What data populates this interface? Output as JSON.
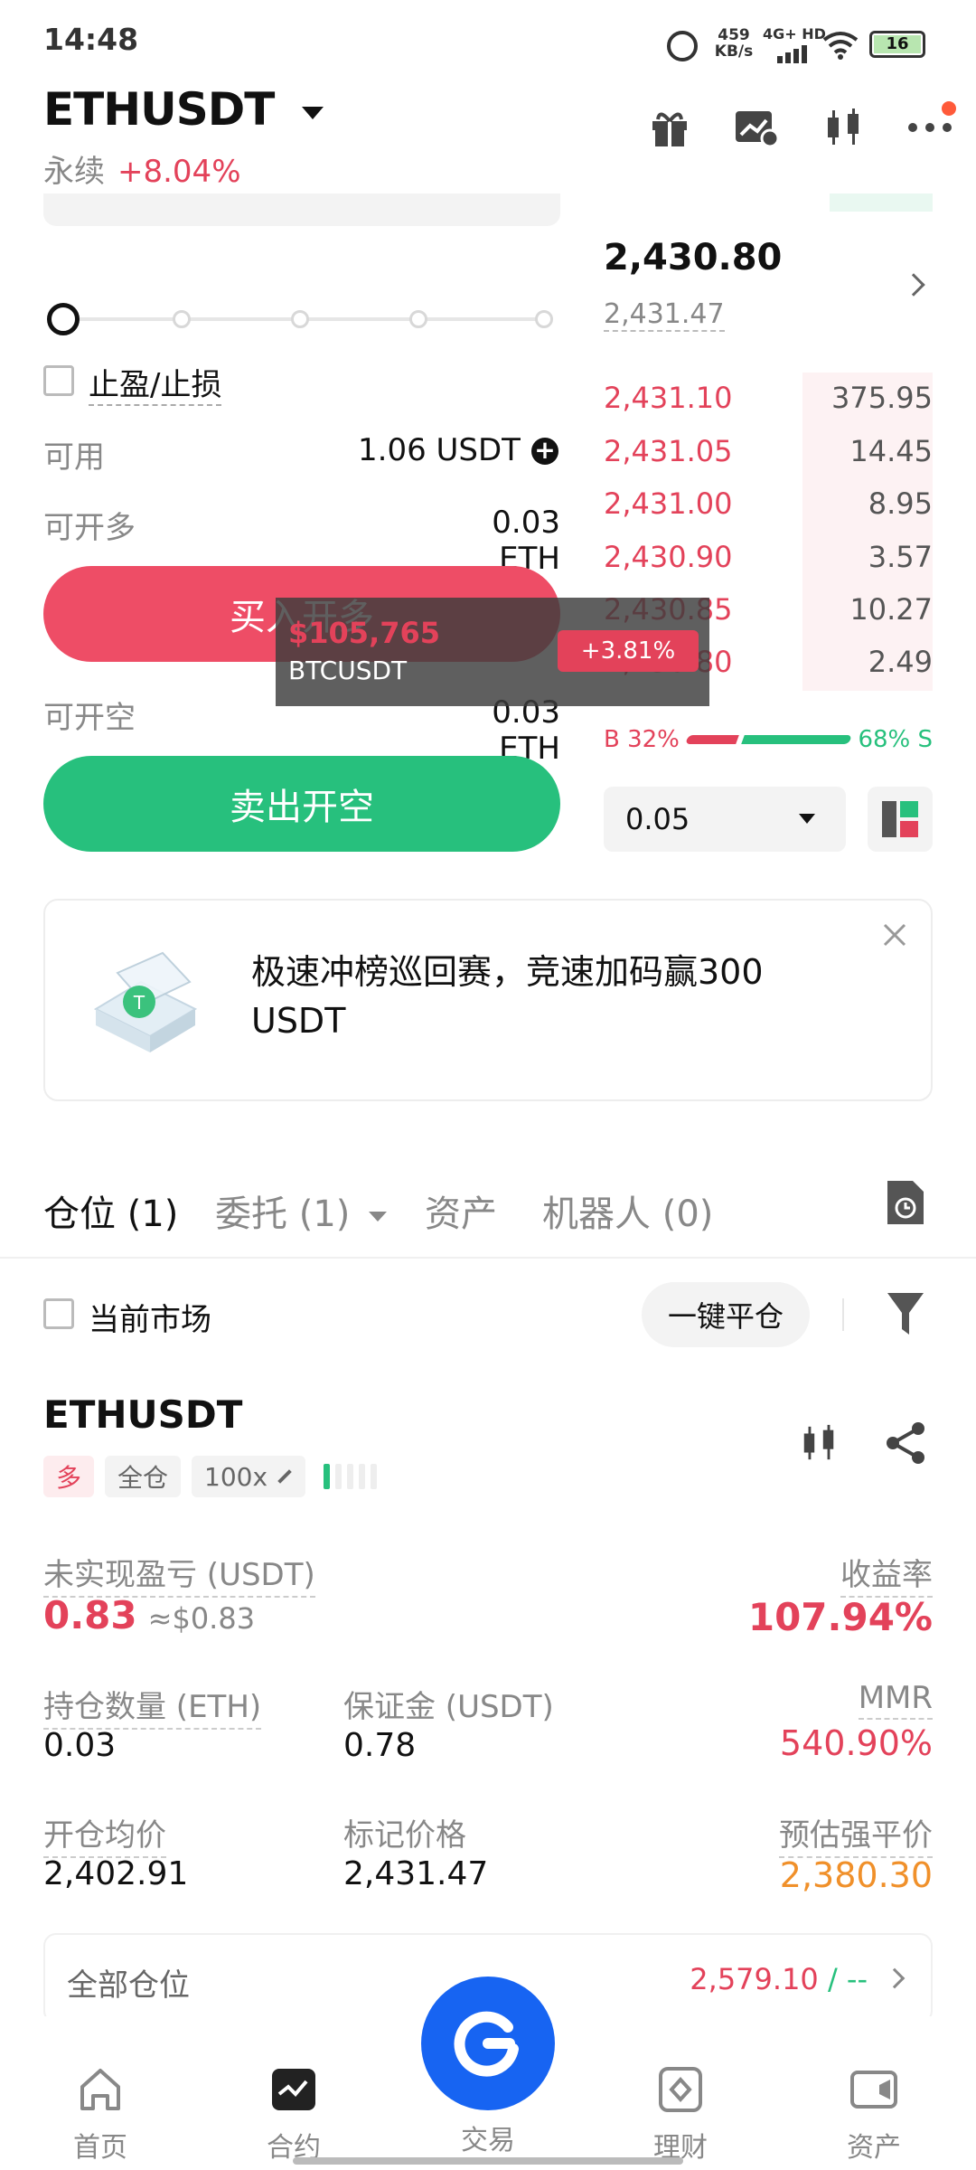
{
  "status_bar": {
    "time": "14:48",
    "speed": "459",
    "speed_unit": "KB/s",
    "network": "4G+ HD",
    "battery": "16"
  },
  "header": {
    "symbol": "ETHUSDT",
    "subtitle": "永续",
    "change": "+8.04%"
  },
  "order_form": {
    "tp_sl_label": "止盈/止损",
    "available_label": "可用",
    "available_value": "1.06 USDT",
    "can_open_long_label": "可开多",
    "can_open_long_value": "0.03 ETH",
    "buy_button": "买入开多",
    "can_open_short_label": "可开空",
    "can_open_short_value": "0.03 ETH",
    "sell_button": "卖出开空"
  },
  "orderbook": {
    "last_price": "2,430.80",
    "mark_price": "2,431.47",
    "asks": [
      {
        "price": "2,431.10",
        "qty": "375.95"
      },
      {
        "price": "2,431.05",
        "qty": "14.45"
      },
      {
        "price": "2,431.00",
        "qty": "8.95"
      },
      {
        "price": "2,430.90",
        "qty": "3.57"
      },
      {
        "price": "2,430.85",
        "qty": "10.27"
      },
      {
        "price": "2,430.80",
        "qty": "2.49"
      }
    ],
    "buy_ratio": "B 32%",
    "sell_ratio": "68% S",
    "buy_fraction": 0.32,
    "precision": "0.05"
  },
  "overlay": {
    "price": "$105,765",
    "symbol": "BTCUSDT",
    "change": "+3.81%"
  },
  "banner": {
    "text": "极速冲榜巡回赛，竞速加码赢300 USDT"
  },
  "tabs": [
    {
      "label": "仓位 (1)"
    },
    {
      "label": "委托 (1)"
    },
    {
      "label": "资产"
    },
    {
      "label": "机器人 (0)"
    }
  ],
  "filters": {
    "current_market_label": "当前市场",
    "close_all_button": "一键平仓"
  },
  "position": {
    "symbol": "ETHUSDT",
    "side_tag": "多",
    "margin_tag": "全仓",
    "leverage_tag": "100x",
    "upnl_label": "未实现盈亏 (USDT)",
    "upnl_value": "0.83",
    "upnl_usd": "≈$0.83",
    "roe_label": "收益率",
    "roe_value": "107.94%",
    "size_label": "持仓数量 (ETH)",
    "size_value": "0.03",
    "margin_label": "保证金 (USDT)",
    "margin_value": "0.78",
    "mmr_label": "MMR",
    "mmr_value": "540.90%",
    "entry_label": "开仓均价",
    "entry_value": "2,402.91",
    "mark_label": "标记价格",
    "mark_value": "2,431.47",
    "liq_label": "预估强平价",
    "liq_value": "2,380.30"
  },
  "all_positions": {
    "label": "全部仓位",
    "value": "2,579.10",
    "suffix": "/ --"
  },
  "bottom_nav": [
    {
      "label": "首页"
    },
    {
      "label": "合约"
    },
    {
      "label": "交易"
    },
    {
      "label": "理财"
    },
    {
      "label": "资产"
    }
  ],
  "colors": {
    "red": "#e3425a",
    "green": "#27c07d",
    "blue": "#1764f2",
    "orange": "#f0902a"
  }
}
